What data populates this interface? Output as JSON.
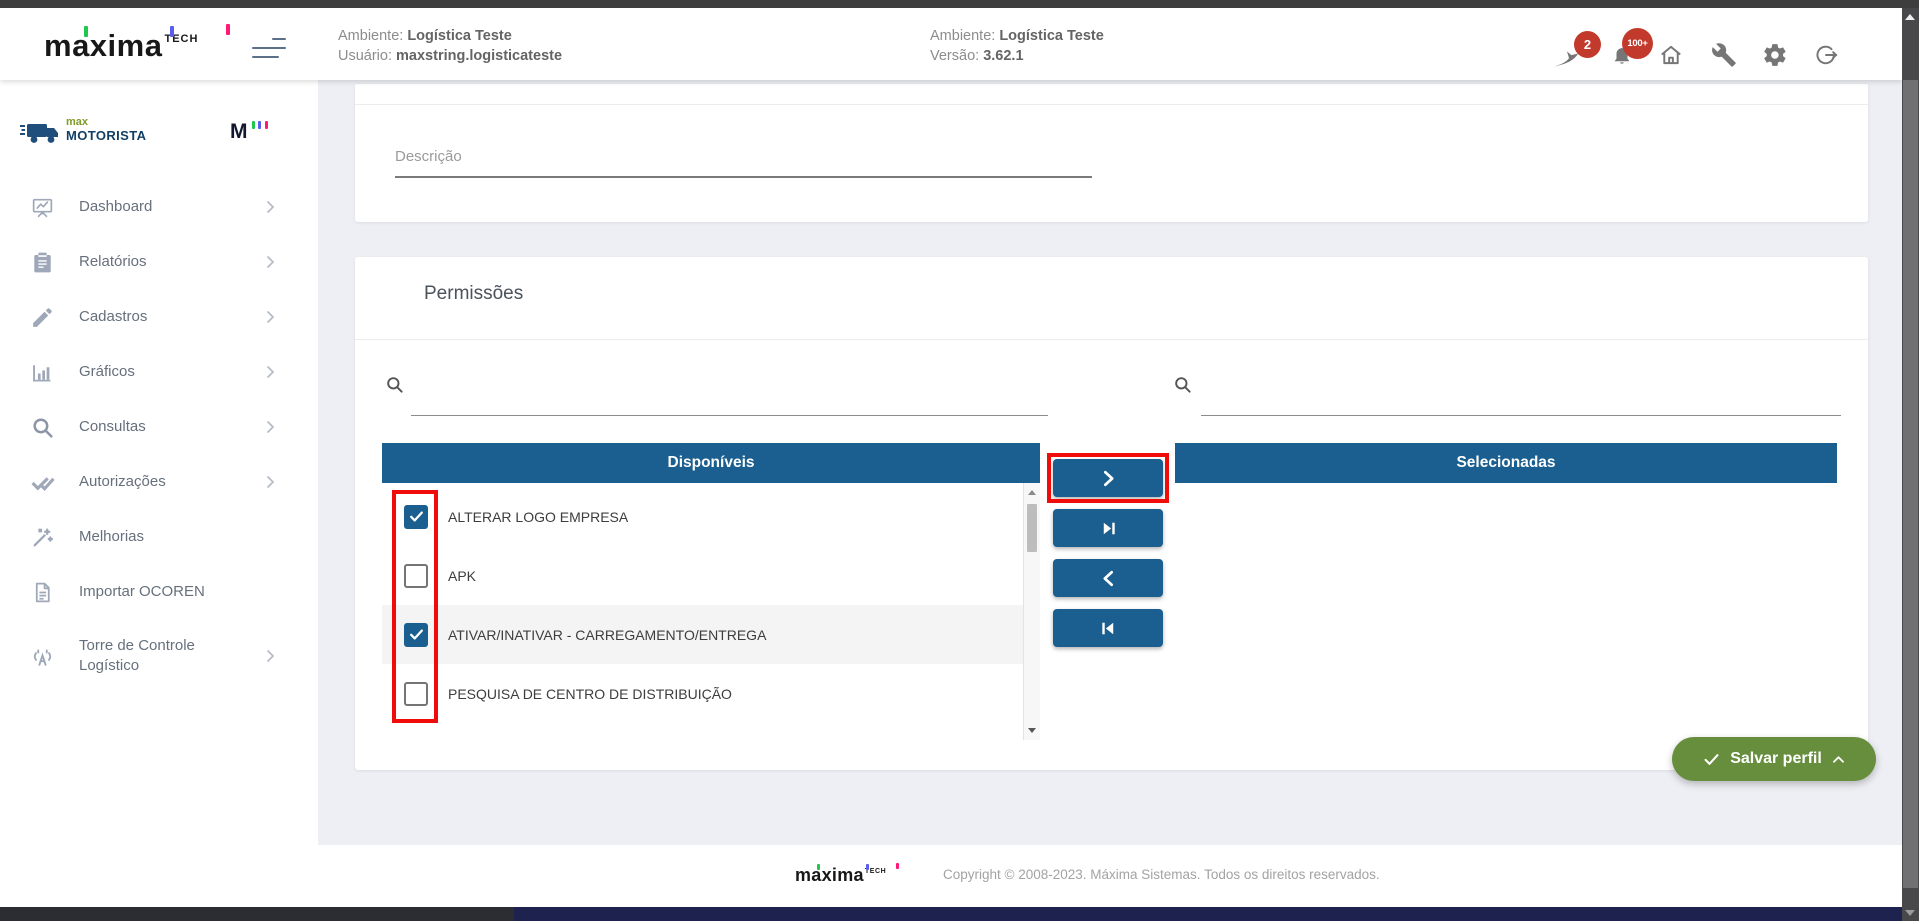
{
  "header": {
    "brand": {
      "name": "maxima",
      "suffix": "TECH"
    },
    "info_left": {
      "line1_label": "Ambiente:",
      "line1_value": "Logística Teste",
      "line2_label": "Usuário:",
      "line2_value": "maxstring.logisticateste"
    },
    "info_right": {
      "line1_label": "Ambiente:",
      "line1_value": "Logística Teste",
      "line2_label": "Versão:",
      "line2_value": "3.62.1"
    },
    "badges": {
      "messages": "2",
      "notifications": "100+"
    },
    "icons": [
      "bird-icon",
      "bell-icon",
      "home-icon",
      "wrench-icon",
      "gear-icon",
      "logout-icon"
    ]
  },
  "sidebar": {
    "logo": {
      "top": "max",
      "bottom": "MOTORISTA",
      "mark": "M"
    },
    "items": [
      {
        "label": "Dashboard",
        "icon": "dashboard-icon",
        "chevron": true
      },
      {
        "label": "Relatórios",
        "icon": "clipboard-icon",
        "chevron": true
      },
      {
        "label": "Cadastros",
        "icon": "pencil-icon",
        "chevron": true
      },
      {
        "label": "Gráficos",
        "icon": "bar-chart-icon",
        "chevron": true
      },
      {
        "label": "Consultas",
        "icon": "search-icon",
        "chevron": true
      },
      {
        "label": "Autorizações",
        "icon": "double-check-icon",
        "chevron": true
      },
      {
        "label": "Melhorias",
        "icon": "magic-wand-icon",
        "chevron": false
      },
      {
        "label": "Importar OCOREN",
        "icon": "document-icon",
        "chevron": false
      },
      {
        "label": "Torre de Controle Logístico",
        "icon": "antenna-icon",
        "chevron": true
      }
    ]
  },
  "main": {
    "description": {
      "label": "Descrição",
      "value": ""
    },
    "permissions": {
      "title": "Permissões",
      "search_left_value": "",
      "search_right_value": "",
      "available_header": "Disponíveis",
      "selected_header": "Selecionadas",
      "available_items": [
        {
          "label": "ALTERAR LOGO EMPRESA",
          "checked": true
        },
        {
          "label": "APK",
          "checked": false
        },
        {
          "label": "ATIVAR/INATIVAR - CARREGAMENTO/ENTREGA",
          "checked": true
        },
        {
          "label": "PESQUISA DE CENTRO DE DISTRIBUIÇÃO",
          "checked": false
        }
      ],
      "selected_items": [],
      "transfer_buttons": [
        "move-right",
        "move-all-right",
        "move-left",
        "move-all-left"
      ],
      "save_label": "Salvar perfil"
    }
  },
  "footer": {
    "brand": {
      "name": "maxima",
      "suffix": "TECH"
    },
    "copyright": "Copyright © 2008-2023. Máxima Sistemas. Todos os direitos reservados."
  },
  "colors": {
    "primary_blue": "#1a5f8f",
    "save_green": "#668e3c",
    "badge_red": "#c23a2b",
    "annotation_red": "#f10c0c",
    "page_background": "#edeff4",
    "top_strip": "#3e3e3e",
    "bottom_strip_navy": "#1d224e"
  }
}
